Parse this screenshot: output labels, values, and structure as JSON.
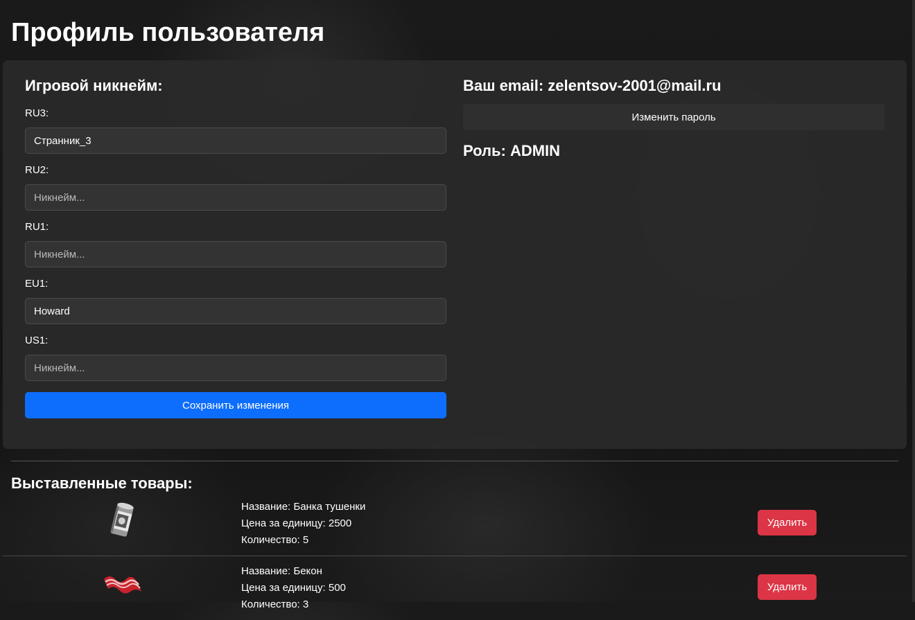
{
  "page_title": "Профиль пользователя",
  "nicknames": {
    "heading": "Игровой никнейм:",
    "fields": [
      {
        "label": "RU3:",
        "value": "Странник_3",
        "placeholder": "Никнейм..."
      },
      {
        "label": "RU2:",
        "value": "",
        "placeholder": "Никнейм..."
      },
      {
        "label": "RU1:",
        "value": "",
        "placeholder": "Никнейм..."
      },
      {
        "label": "EU1:",
        "value": "Howard",
        "placeholder": "Никнейм..."
      },
      {
        "label": "US1:",
        "value": "",
        "placeholder": "Никнейм..."
      }
    ],
    "save_label": "Сохранить изменения"
  },
  "account": {
    "email_heading": "Ваш email: zelentsov-2001@mail.ru",
    "change_password_label": "Изменить пароль",
    "role_heading": "Роль: ADMIN"
  },
  "listings": {
    "title": "Выставленные товары:",
    "items": [
      {
        "name": "Название: Банка тушенки",
        "price": "Цена за единицу: 2500",
        "quantity": "Количество: 5",
        "delete_label": "Удалить",
        "image_icon": "canned-meat-icon"
      },
      {
        "name": "Название: Бекон",
        "price": "Цена за единицу: 500",
        "quantity": "Количество: 3",
        "delete_label": "Удалить",
        "image_icon": "bacon-icon"
      }
    ]
  },
  "colors": {
    "primary": "#0d6efd",
    "danger": "#dc3545",
    "card_bg": "#2a2a2a",
    "input_bg": "#333334"
  }
}
